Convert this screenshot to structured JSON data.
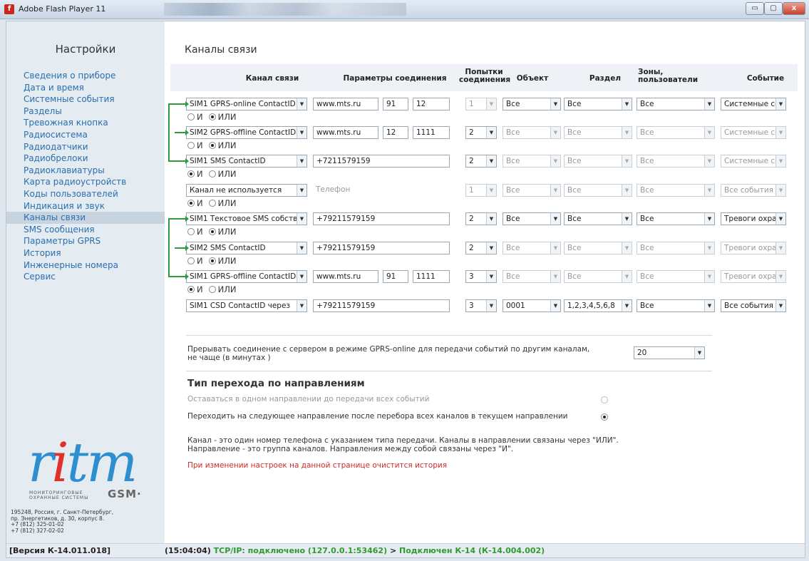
{
  "window": {
    "title": "Adobe Flash Player 11",
    "min": "▭",
    "max": "▢",
    "close": "x"
  },
  "sidebar": {
    "title": "Настройки",
    "items": [
      "Сведения о приборе",
      "Дата и время",
      "Системные события",
      "Разделы",
      "Тревожная кнопка",
      "Радиосистема",
      "Радиодатчики",
      "Радиобрелоки",
      "Радиоклавиатуры",
      "Карта радиоустройств",
      "Коды пользователей",
      "Индикация и звук",
      "Каналы связи",
      "SMS сообщения",
      "Параметры GPRS",
      "История",
      "Инженерные номера",
      "Сервис"
    ],
    "active_item": "Каналы связи",
    "logo_text": "ritm",
    "logo_sub": "МОНИТОРИНГОВЫЕ\nОХРАННЫЕ СИСТЕМЫ",
    "logo_gsm": "GSM·",
    "address": "195248, Россия, г. Санкт-Петербург,\nпр. Энергетиков, д. 30, корпус 8.\n+7 (812) 325-01-02\n+7 (812) 327-02-02"
  },
  "status": {
    "version": "[Версия К-14.011.018]",
    "time": "(15:04:04)",
    "conn": "TCP/IP: подключено (127.0.0.1:53462)",
    "sep": ">",
    "device": "Подключен К-14 (К-14.004.002)"
  },
  "main": {
    "title": "Каналы связи",
    "headers": {
      "channel": "Канал связи",
      "params": "Параметры соединения",
      "attempts": "Попытки\nсоединения",
      "object": "Объект",
      "section": "Раздел",
      "zones": "Зоны,\nпользователи",
      "event": "Событие"
    },
    "radio_labels": {
      "and": "И",
      "or": "ИЛИ"
    },
    "rows": [
      {
        "channel": "SIM1 GPRS-online ContactID",
        "host": "www.mts.ru",
        "p1": "91",
        "p2": "12",
        "attempts": "1",
        "object": "Все",
        "section": "Все",
        "zones": "Все",
        "event": "Системные со",
        "att_dis": true,
        "obj_dis": false,
        "link": "or"
      },
      {
        "channel": "SIM2 GPRS-offline ContactID",
        "host": "www.mts.ru",
        "p1": "12",
        "p2": "1111",
        "attempts": "2",
        "object": "Все",
        "section": "Все",
        "zones": "Все",
        "event": "Системные со",
        "att_dis": false,
        "obj_dis": true,
        "link": "or"
      },
      {
        "channel": "SIM1 SMS ContactID",
        "phone": "+7211579159",
        "attempts": "2",
        "object": "Все",
        "section": "Все",
        "zones": "Все",
        "event": "Системные со",
        "att_dis": false,
        "obj_dis": true,
        "link": "and"
      },
      {
        "channel": "Канал не используется",
        "phone_placeholder": "Телефон",
        "attempts": "1",
        "object": "Все",
        "section": "Все",
        "zones": "Все",
        "event": "Все события",
        "att_dis": true,
        "obj_dis": true,
        "link": "and"
      },
      {
        "channel": "SIM1 Текстовое SMS собств",
        "phone": "+79211579159",
        "attempts": "2",
        "object": "Все",
        "section": "Все",
        "zones": "Все",
        "event": "Тревоги охра",
        "att_dis": false,
        "obj_dis": false,
        "link": "or"
      },
      {
        "channel": "SIM2 SMS ContactID",
        "phone": "+79211579159",
        "attempts": "2",
        "object": "Все",
        "section": "Все",
        "zones": "Все",
        "event": "Тревоги охра",
        "att_dis": false,
        "obj_dis": true,
        "link": "or"
      },
      {
        "channel": "SIM1 GPRS-offline ContactID",
        "host": "www.mts.ru",
        "p1": "91",
        "p2": "1111",
        "attempts": "3",
        "object": "Все",
        "section": "Все",
        "zones": "Все",
        "event": "Тревоги охра",
        "att_dis": false,
        "obj_dis": true,
        "link": "and"
      },
      {
        "channel": "SIM1 CSD ContactID через",
        "phone": "+79211579159",
        "attempts": "3",
        "object": "0001",
        "section": "1,2,3,4,5,6,8",
        "zones": "Все",
        "event": "Все события",
        "att_dis": false,
        "obj_dis": false
      }
    ],
    "gprs_break": {
      "text": "Прерывать соединение с сервером в режиме GPRS-online для передачи событий по другим каналам,\nне чаще (в минутах )",
      "value": "20"
    },
    "direction": {
      "title": "Тип перехода по направлениям",
      "options": [
        {
          "label": "Оставаться в одном направлении до передачи всех событий",
          "selected": false
        },
        {
          "label": "Переходить на следующее направление после перебора  всех каналов в текущем направлении",
          "selected": true
        }
      ]
    },
    "notes": [
      "Канал - это  один номер телефона с указанием типа передачи. Каналы в направлении связаны через \"ИЛИ\".",
      "Направление - это группа каналов. Направления между собой связаны через \"И\"."
    ],
    "warning": "При изменении настроек на данной странице очистится история"
  }
}
